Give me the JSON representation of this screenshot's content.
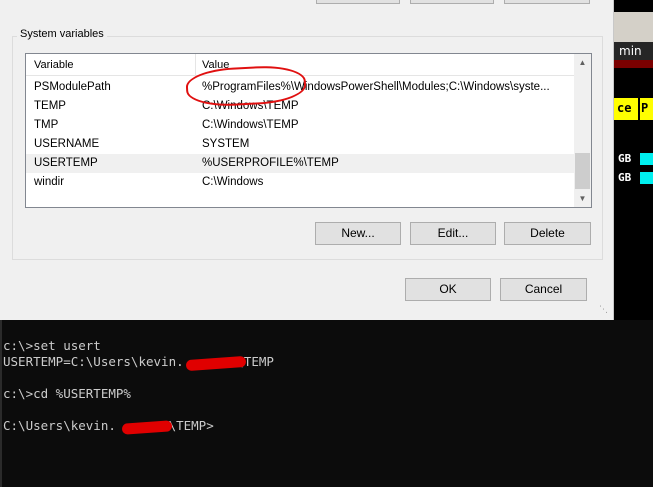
{
  "dialog": {
    "group_title": "System variables",
    "columns": {
      "variable": "Variable",
      "value": "Value"
    },
    "rows": [
      {
        "variable": "PSModulePath",
        "value": "%ProgramFiles%\\WindowsPowerShell\\Modules;C:\\Windows\\syste..."
      },
      {
        "variable": "TEMP",
        "value": "C:\\Windows\\TEMP"
      },
      {
        "variable": "TMP",
        "value": "C:\\Windows\\TEMP"
      },
      {
        "variable": "USERNAME",
        "value": "SYSTEM"
      },
      {
        "variable": "USERTEMP",
        "value": "%USERPROFILE%\\TEMP",
        "selected": true
      },
      {
        "variable": "windir",
        "value": "C:\\Windows"
      }
    ],
    "buttons": {
      "new": "New...",
      "edit": "Edit...",
      "delete": "Delete",
      "ok": "OK",
      "cancel": "Cancel"
    }
  },
  "side_panel": {
    "title": "min",
    "label_left": "ce",
    "label_right": "P",
    "gb_1": "GB",
    "gb_2": "GB"
  },
  "console": {
    "lines": [
      "c:\\>set usert",
      "USERTEMP=C:\\Users\\kevin.       \\TEMP",
      "",
      "c:\\>cd %USERTEMP%",
      "",
      "C:\\Users\\kevin.       \\TEMP>"
    ]
  },
  "colors": {
    "annotation_red": "#e01010",
    "console_bg": "#0c0c0c",
    "console_text": "#cccccc",
    "dialog_bg": "#f0f0f0"
  }
}
